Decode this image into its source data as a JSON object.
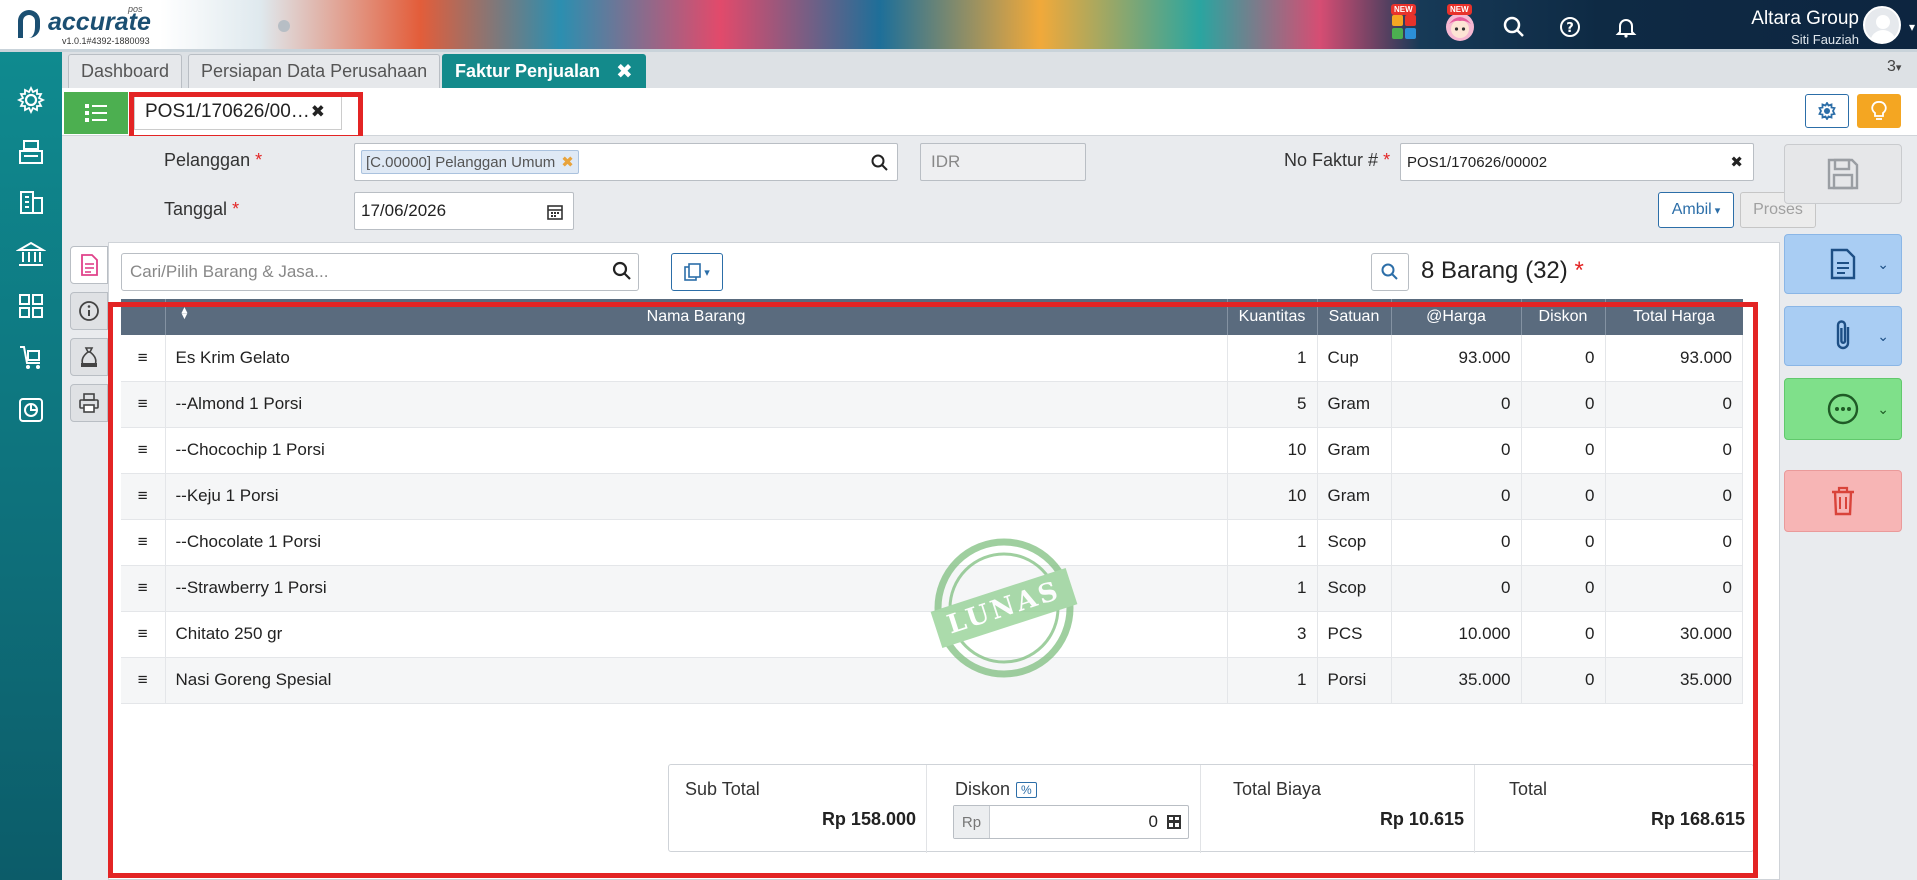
{
  "app": {
    "logo_text": "accurate",
    "logo_sub": "pos",
    "version": "v1.0.1#4392-1880093",
    "badge_new": "NEW",
    "company": "Altara Group",
    "user": "Siti Fauziah"
  },
  "tabs": [
    {
      "label": "Dashboard"
    },
    {
      "label": "Persiapan Data Perusahaan"
    },
    {
      "label": "Faktur Penjualan"
    }
  ],
  "tab_count": "3",
  "document_tab": "POS1/170626/00…",
  "form": {
    "pelanggan_label": "Pelanggan",
    "pelanggan_value": "[C.00000] Pelanggan Umum",
    "currency": "IDR",
    "no_faktur_label": "No Faktur #",
    "no_faktur_value": "POS1/170626/00002",
    "tanggal_label": "Tanggal",
    "tanggal_value": "17/06/2026",
    "ambil_label": "Ambil",
    "proses_label": "Proses",
    "required_mark": "*"
  },
  "detail": {
    "search_placeholder": "Cari/Pilih Barang & Jasa...",
    "count_text": "8 Barang (32)",
    "columns": [
      "Nama Barang",
      "Kuantitas",
      "Satuan",
      "@Harga",
      "Diskon",
      "Total Harga"
    ],
    "rows": [
      {
        "name": "Es Krim Gelato",
        "qty": "1",
        "unit": "Cup",
        "price": "93.000",
        "disc": "0",
        "total": "93.000"
      },
      {
        "name": "--Almond 1 Porsi",
        "qty": "5",
        "unit": "Gram",
        "price": "0",
        "disc": "0",
        "total": "0"
      },
      {
        "name": "--Chocochip 1 Porsi",
        "qty": "10",
        "unit": "Gram",
        "price": "0",
        "disc": "0",
        "total": "0"
      },
      {
        "name": "--Keju 1 Porsi",
        "qty": "10",
        "unit": "Gram",
        "price": "0",
        "disc": "0",
        "total": "0"
      },
      {
        "name": "--Chocolate 1 Porsi",
        "qty": "1",
        "unit": "Scop",
        "price": "0",
        "disc": "0",
        "total": "0"
      },
      {
        "name": "--Strawberry 1 Porsi",
        "qty": "1",
        "unit": "Scop",
        "price": "0",
        "disc": "0",
        "total": "0"
      },
      {
        "name": "Chitato 250 gr",
        "qty": "3",
        "unit": "PCS",
        "price": "10.000",
        "disc": "0",
        "total": "30.000"
      },
      {
        "name": "Nasi Goreng Spesial",
        "qty": "1",
        "unit": "Porsi",
        "price": "35.000",
        "disc": "0",
        "total": "35.000"
      }
    ],
    "stamp_text": "LUNAS"
  },
  "totals": {
    "subtotal_label": "Sub Total",
    "subtotal_value": "Rp 158.000",
    "diskon_label": "Diskon",
    "diskon_pct": "%",
    "diskon_prefix": "Rp",
    "diskon_value": "0",
    "biaya_label": "Total Biaya",
    "biaya_value": "Rp 10.615",
    "total_label": "Total",
    "total_value": "Rp 168.615"
  },
  "colors": {
    "teal": "#138a8b",
    "green": "#4caf50",
    "red_highlight": "#e32424",
    "action_blue": "#a9cdf3",
    "action_green": "#7fe08a",
    "action_red": "#f7b5b5"
  }
}
